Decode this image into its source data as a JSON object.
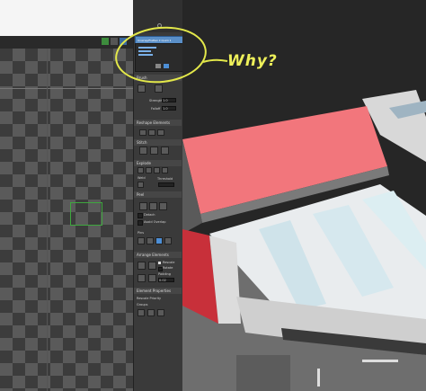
{
  "uv_editor": {
    "panel_dropdown_label": "Unwrap/Flatten ▾ Quick ▾"
  },
  "rollouts": {
    "brush": "Brush",
    "brush_strength": "Strength",
    "brush_falloff": "Falloff",
    "brush_strength_value": "1.0",
    "brush_falloff_value": "1.0",
    "reshape": "Reshape Elements",
    "stitch": "Stitch",
    "explode": "Explode",
    "explode_threshold": "Threshold",
    "explode_weld": "Weld",
    "peel": "Peel",
    "peel_detach": "Detach",
    "peel_avoid_overlap": "Avoid Overlap",
    "peel_pins": "Pins",
    "arrange": "Arrange Elements",
    "arrange_rescale": "Rescale",
    "arrange_rotate": "Rotate",
    "arrange_padding": "Padding",
    "arrange_padding_value": "0.02",
    "element_properties": "Element Properties",
    "rescale_priority": "Rescale Priority",
    "groups": "Groups"
  },
  "annotation": {
    "text": "Why?"
  },
  "colors": {
    "annotation": "#e3e84a",
    "selected_roof": "#f2767c",
    "accent": "#4d8fd6"
  }
}
